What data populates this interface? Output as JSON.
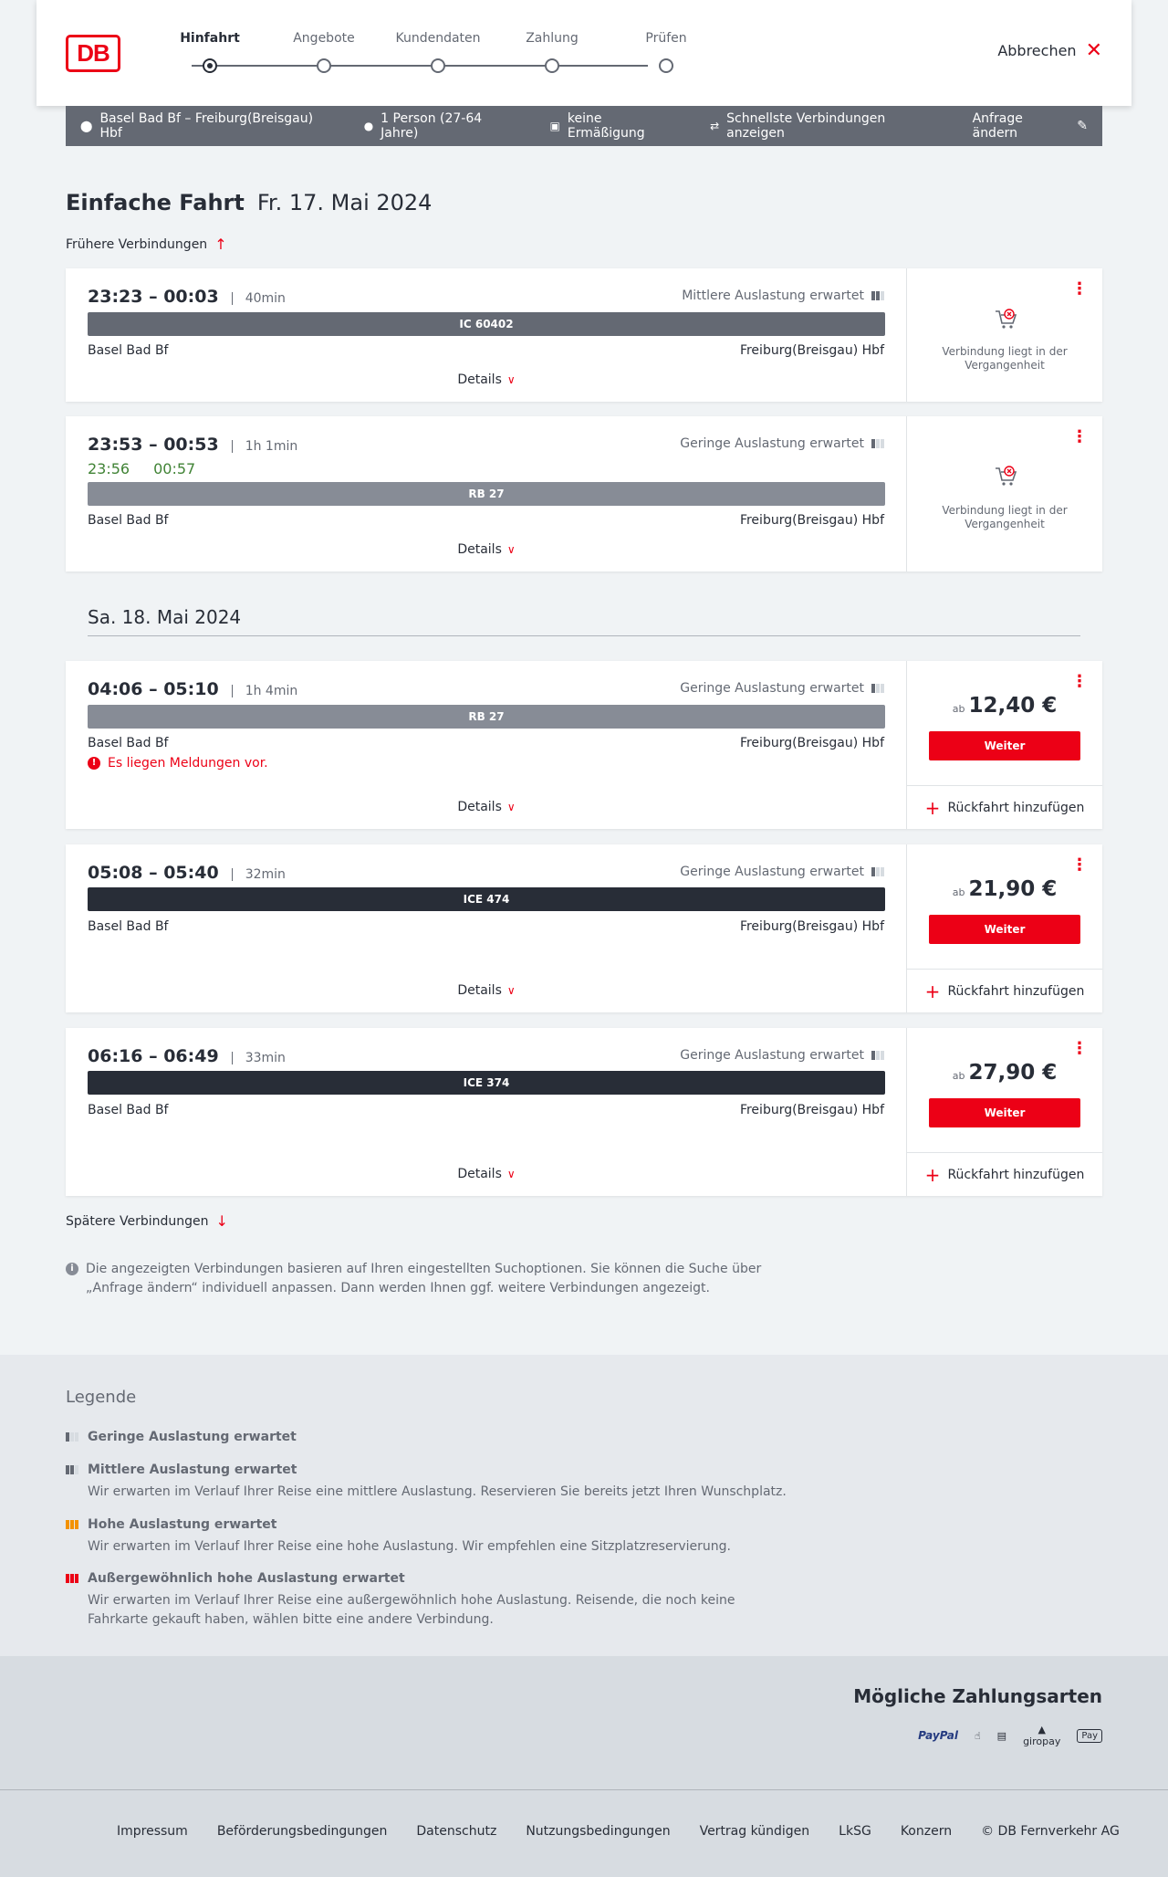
{
  "header": {
    "logo": "DB",
    "steps": [
      "Hinfahrt",
      "Angebote",
      "Kundendaten",
      "Zahlung",
      "Prüfen"
    ],
    "cancel": "Abbrechen"
  },
  "summary": {
    "route": "Basel Bad Bf – Freiburg(Breisgau) Hbf",
    "persons": "1 Person (27-64 Jahre)",
    "discount": "keine Ermäßigung",
    "mode": "Schnellste Verbindungen anzeigen",
    "change": "Anfrage ändern"
  },
  "title": {
    "type": "Einfache Fahrt",
    "date": "Fr. 17. Mai 2024"
  },
  "earlier": "Frühere Verbindungen",
  "later": "Spätere Verbindungen",
  "date2": "Sa. 18. Mai 2024",
  "details": "Details",
  "past": "Verbindung liegt in der Vergangenheit",
  "ab": "ab",
  "weiter": "Weiter",
  "return": "Rückfahrt hinzufügen",
  "connections": [
    {
      "times": "23:23 – 00:03",
      "duration": "40min",
      "occupancy": "Mittlere Auslastung erwartet",
      "train": "IC 60402",
      "from": "Basel Bad Bf",
      "to": "Freiburg(Breisgau) Hbf"
    },
    {
      "times": "23:53 – 00:53",
      "duration": "1h 1min",
      "rt_dep": "23:56",
      "rt_arr": "00:57",
      "occupancy": "Geringe Auslastung erwartet",
      "train": "RB 27",
      "from": "Basel Bad Bf",
      "to": "Freiburg(Breisgau) Hbf"
    },
    {
      "times": "04:06 – 05:10",
      "duration": "1h 4min",
      "occupancy": "Geringe Auslastung erwartet",
      "train": "RB 27",
      "from": "Basel Bad Bf",
      "to": "Freiburg(Breisgau) Hbf",
      "message": "Es liegen Meldungen vor.",
      "price": "12,40 €"
    },
    {
      "times": "05:08 – 05:40",
      "duration": "32min",
      "occupancy": "Geringe Auslastung erwartet",
      "train": "ICE 474",
      "from": "Basel Bad Bf",
      "to": "Freiburg(Breisgau) Hbf",
      "price": "21,90 €"
    },
    {
      "times": "06:16 – 06:49",
      "duration": "33min",
      "occupancy": "Geringe Auslastung erwartet",
      "train": "ICE 374",
      "from": "Basel Bad Bf",
      "to": "Freiburg(Breisgau) Hbf",
      "price": "27,90 €"
    }
  ],
  "info": "Die angezeigten Verbindungen basieren auf Ihren eingestellten Suchoptionen. Sie können die Suche über „Anfrage ändern“ individuell anpassen. Dann werden Ihnen ggf. weitere Verbindungen angezeigt.",
  "legend": {
    "title": "Legende",
    "items": [
      {
        "title": "Geringe Auslastung erwartet",
        "text": ""
      },
      {
        "title": "Mittlere Auslastung erwartet",
        "text": "Wir erwarten im Verlauf Ihrer Reise eine mittlere Auslastung. Reservieren Sie bereits jetzt Ihren Wunschplatz."
      },
      {
        "title": "Hohe Auslastung erwartet",
        "text": "Wir erwarten im Verlauf Ihrer Reise eine hohe Auslastung. Wir empfehlen eine Sitzplatzreservierung."
      },
      {
        "title": "Außergewöhnlich hohe Auslastung erwartet",
        "text": "Wir erwarten im Verlauf Ihrer Reise eine außergewöhnlich hohe Auslastung. Reisende, die noch keine Fahrkarte gekauft haben, wählen bitte eine andere Verbindung."
      }
    ]
  },
  "payment": {
    "title": "Mögliche Zahlungsarten",
    "methods": [
      "PayPal",
      "giropay",
      "Pay"
    ]
  },
  "footer": [
    "Impressum",
    "Beförderungsbedingungen",
    "Datenschutz",
    "Nutzungsbedingungen",
    "Vertrag kündigen",
    "LkSG",
    "Konzern",
    "© DB Fernverkehr AG"
  ],
  "colors": {
    "accent": "#ec0016",
    "ic": "#646973",
    "rb": "#878c96",
    "ice": "#282d37",
    "realtime": "#408335"
  }
}
